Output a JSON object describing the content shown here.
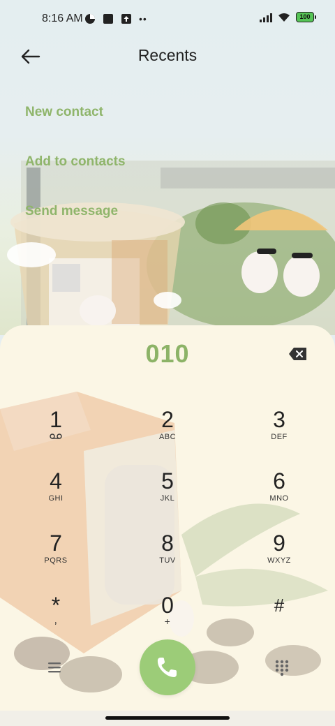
{
  "status_bar": {
    "time": "8:16 AM",
    "battery": "100",
    "left_icons": [
      "app-circle-icon",
      "square-notification-icon",
      "upload-icon",
      "more-dots-icon"
    ],
    "right_icons": [
      "signal-icon",
      "wifi-icon",
      "battery-icon"
    ]
  },
  "header": {
    "title": "Recents",
    "back_icon": "arrow-left-icon"
  },
  "actions": [
    {
      "label": "New contact"
    },
    {
      "label": "Add to contacts"
    },
    {
      "label": "Send message"
    }
  ],
  "dialer": {
    "number": "010",
    "backspace_icon": "backspace-icon",
    "keys": [
      {
        "digit": "1",
        "letters": ""
      },
      {
        "digit": "2",
        "letters": "ABC"
      },
      {
        "digit": "3",
        "letters": "DEF"
      },
      {
        "digit": "4",
        "letters": "GHI"
      },
      {
        "digit": "5",
        "letters": "JKL"
      },
      {
        "digit": "6",
        "letters": "MNO"
      },
      {
        "digit": "7",
        "letters": "PQRS"
      },
      {
        "digit": "8",
        "letters": "TUV"
      },
      {
        "digit": "9",
        "letters": "WXYZ"
      },
      {
        "digit": "*",
        "letters": ","
      },
      {
        "digit": "0",
        "letters": "+"
      },
      {
        "digit": "#",
        "letters": ""
      }
    ],
    "bottom": {
      "left_icon": "menu-icon",
      "call_icon": "phone-icon",
      "right_icon": "dialpad-icon"
    }
  },
  "colors": {
    "accent_green": "#8cb367",
    "call_button": "#9ccc78",
    "sheet_background": "#fbf6e5"
  }
}
